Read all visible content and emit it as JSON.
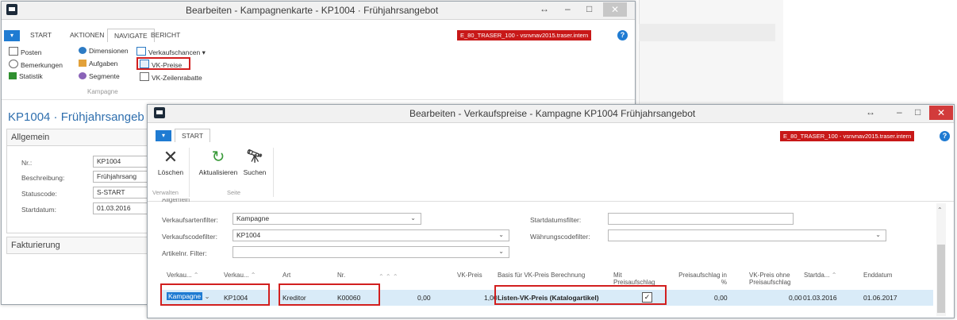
{
  "back_window": {
    "title": "Bearbeiten - Kampagnenkarte - KP1004 · Frühjahrsangebot",
    "tabs": [
      "START",
      "AKTIONEN",
      "NAVIGATE",
      "BERICHT"
    ],
    "server": "E_80_TRASER_100 - vsnvnav2015.traser.intern",
    "ribbon": {
      "posten": "Posten",
      "bemerkungen": "Bemerkungen",
      "statistik": "Statistik",
      "dimensionen": "Dimensionen",
      "aufgaben": "Aufgaben",
      "segmente": "Segmente",
      "verkaufschancen": "Verkaufschancen",
      "vk_preise": "VK-Preise",
      "vk_zeilenrabatte": "VK-Zeilenrabatte",
      "group_label": "Kampagne"
    },
    "card_title": "KP1004 · Frühjahrsangeb",
    "section_allgemein": "Allgemein",
    "fields": {
      "nr_label": "Nr.:",
      "nr_value": "KP1004",
      "beschreibung_label": "Beschreibung:",
      "beschreibung_value": "Frühjahrsang",
      "status_label": "Statuscode:",
      "status_value": "S-START",
      "start_label": "Startdatum:",
      "start_value": "01.03.2016"
    },
    "section_fakturierung": "Fakturierung"
  },
  "front_window": {
    "title": "Bearbeiten - Verkaufspreise - Kampagne KP1004 Frühjahrsangebot",
    "tab": "START",
    "server": "E_80_TRASER_100 - vsnvnav2015.traser.intern",
    "actions": {
      "loeschen": "Löschen",
      "aktualisieren": "Aktualisieren",
      "suchen": "Suchen",
      "group_verwalten": "Verwalten",
      "group_seite": "Seite"
    },
    "section_heading": "Allgemein",
    "filters": {
      "verkaufsartenfilter_label": "Verkaufsartenfilter:",
      "verkaufsartenfilter_value": "Kampagne",
      "verkaufscodefilter_label": "Verkaufscodefilter:",
      "verkaufscodefilter_value": "KP1004",
      "artikelnr_label": "Artikelnr. Filter:",
      "artikelnr_value": "",
      "startdatumsfilter_label": "Startdatumsfilter:",
      "startdatumsfilter_value": "",
      "waehrungscodefilter_label": "Währungscodefilter:",
      "waehrungscodefilter_value": ""
    },
    "columns": {
      "verkaufsart": "Verkau...",
      "verkaufscode": "Verkau...",
      "art": "Art",
      "nr": "Nr.",
      "vk_preis": "VK-Preis",
      "basis": "Basis für VK-Preis Berechnung",
      "mit_preisaufschlag": "Mit Preisaufschlag",
      "preisaufschlag": "Preisaufschlag in %",
      "vk_ohne": "VK-Preis ohne Preisaufschlag",
      "startdatum": "Startda...",
      "enddatum": "Enddatum"
    },
    "row": {
      "verkaufsart": "Kampagne",
      "verkaufscode": "KP1004",
      "art": "Kreditor",
      "nr": "K00060",
      "extra": "0,00",
      "vk_preis": "1,00",
      "basis": "Listen-VK-Preis (Katalogartikel)",
      "mit_preisaufschlag": true,
      "preisaufschlag": "0,00",
      "vk_ohne": "0,00",
      "startdatum": "01.03.2016",
      "enddatum": "01.06.2017"
    }
  }
}
